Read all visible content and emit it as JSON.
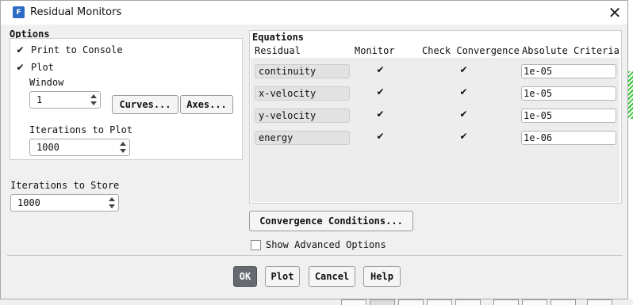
{
  "window": {
    "title": "Residual Monitors",
    "app_icon": "F"
  },
  "options": {
    "label": "Options",
    "print_to_console": {
      "label": "Print to Console",
      "checked": true
    },
    "plot": {
      "label": "Plot",
      "checked": true
    },
    "window_label": "Window",
    "window_value": "1",
    "curves_button": "Curves...",
    "axes_button": "Axes...",
    "iterations_to_plot_label": "Iterations to Plot",
    "iterations_to_plot_value": "1000"
  },
  "iterations_to_store": {
    "label": "Iterations to Store",
    "value": "1000"
  },
  "equations": {
    "label": "Equations",
    "headers": {
      "residual": "Residual",
      "monitor": "Monitor",
      "check": "Check Convergence",
      "criteria": "Absolute Criteria"
    },
    "rows": [
      {
        "residual": "continuity",
        "monitor": true,
        "check": true,
        "criteria": "1e-05"
      },
      {
        "residual": "x-velocity",
        "monitor": true,
        "check": true,
        "criteria": "1e-05"
      },
      {
        "residual": "y-velocity",
        "monitor": true,
        "check": true,
        "criteria": "1e-05"
      },
      {
        "residual": "energy",
        "monitor": true,
        "check": true,
        "criteria": "1e-06"
      }
    ]
  },
  "convergence_conditions_button": "Convergence Conditions...",
  "show_advanced": {
    "label": "Show Advanced Options",
    "checked": false
  },
  "footer": {
    "ok": "OK",
    "plot": "Plot",
    "cancel": "Cancel",
    "help": "Help"
  },
  "icons": {
    "close": "close-icon",
    "check": "check-icon",
    "spin_up": "spin-up-icon",
    "spin_down": "spin-down-icon"
  }
}
